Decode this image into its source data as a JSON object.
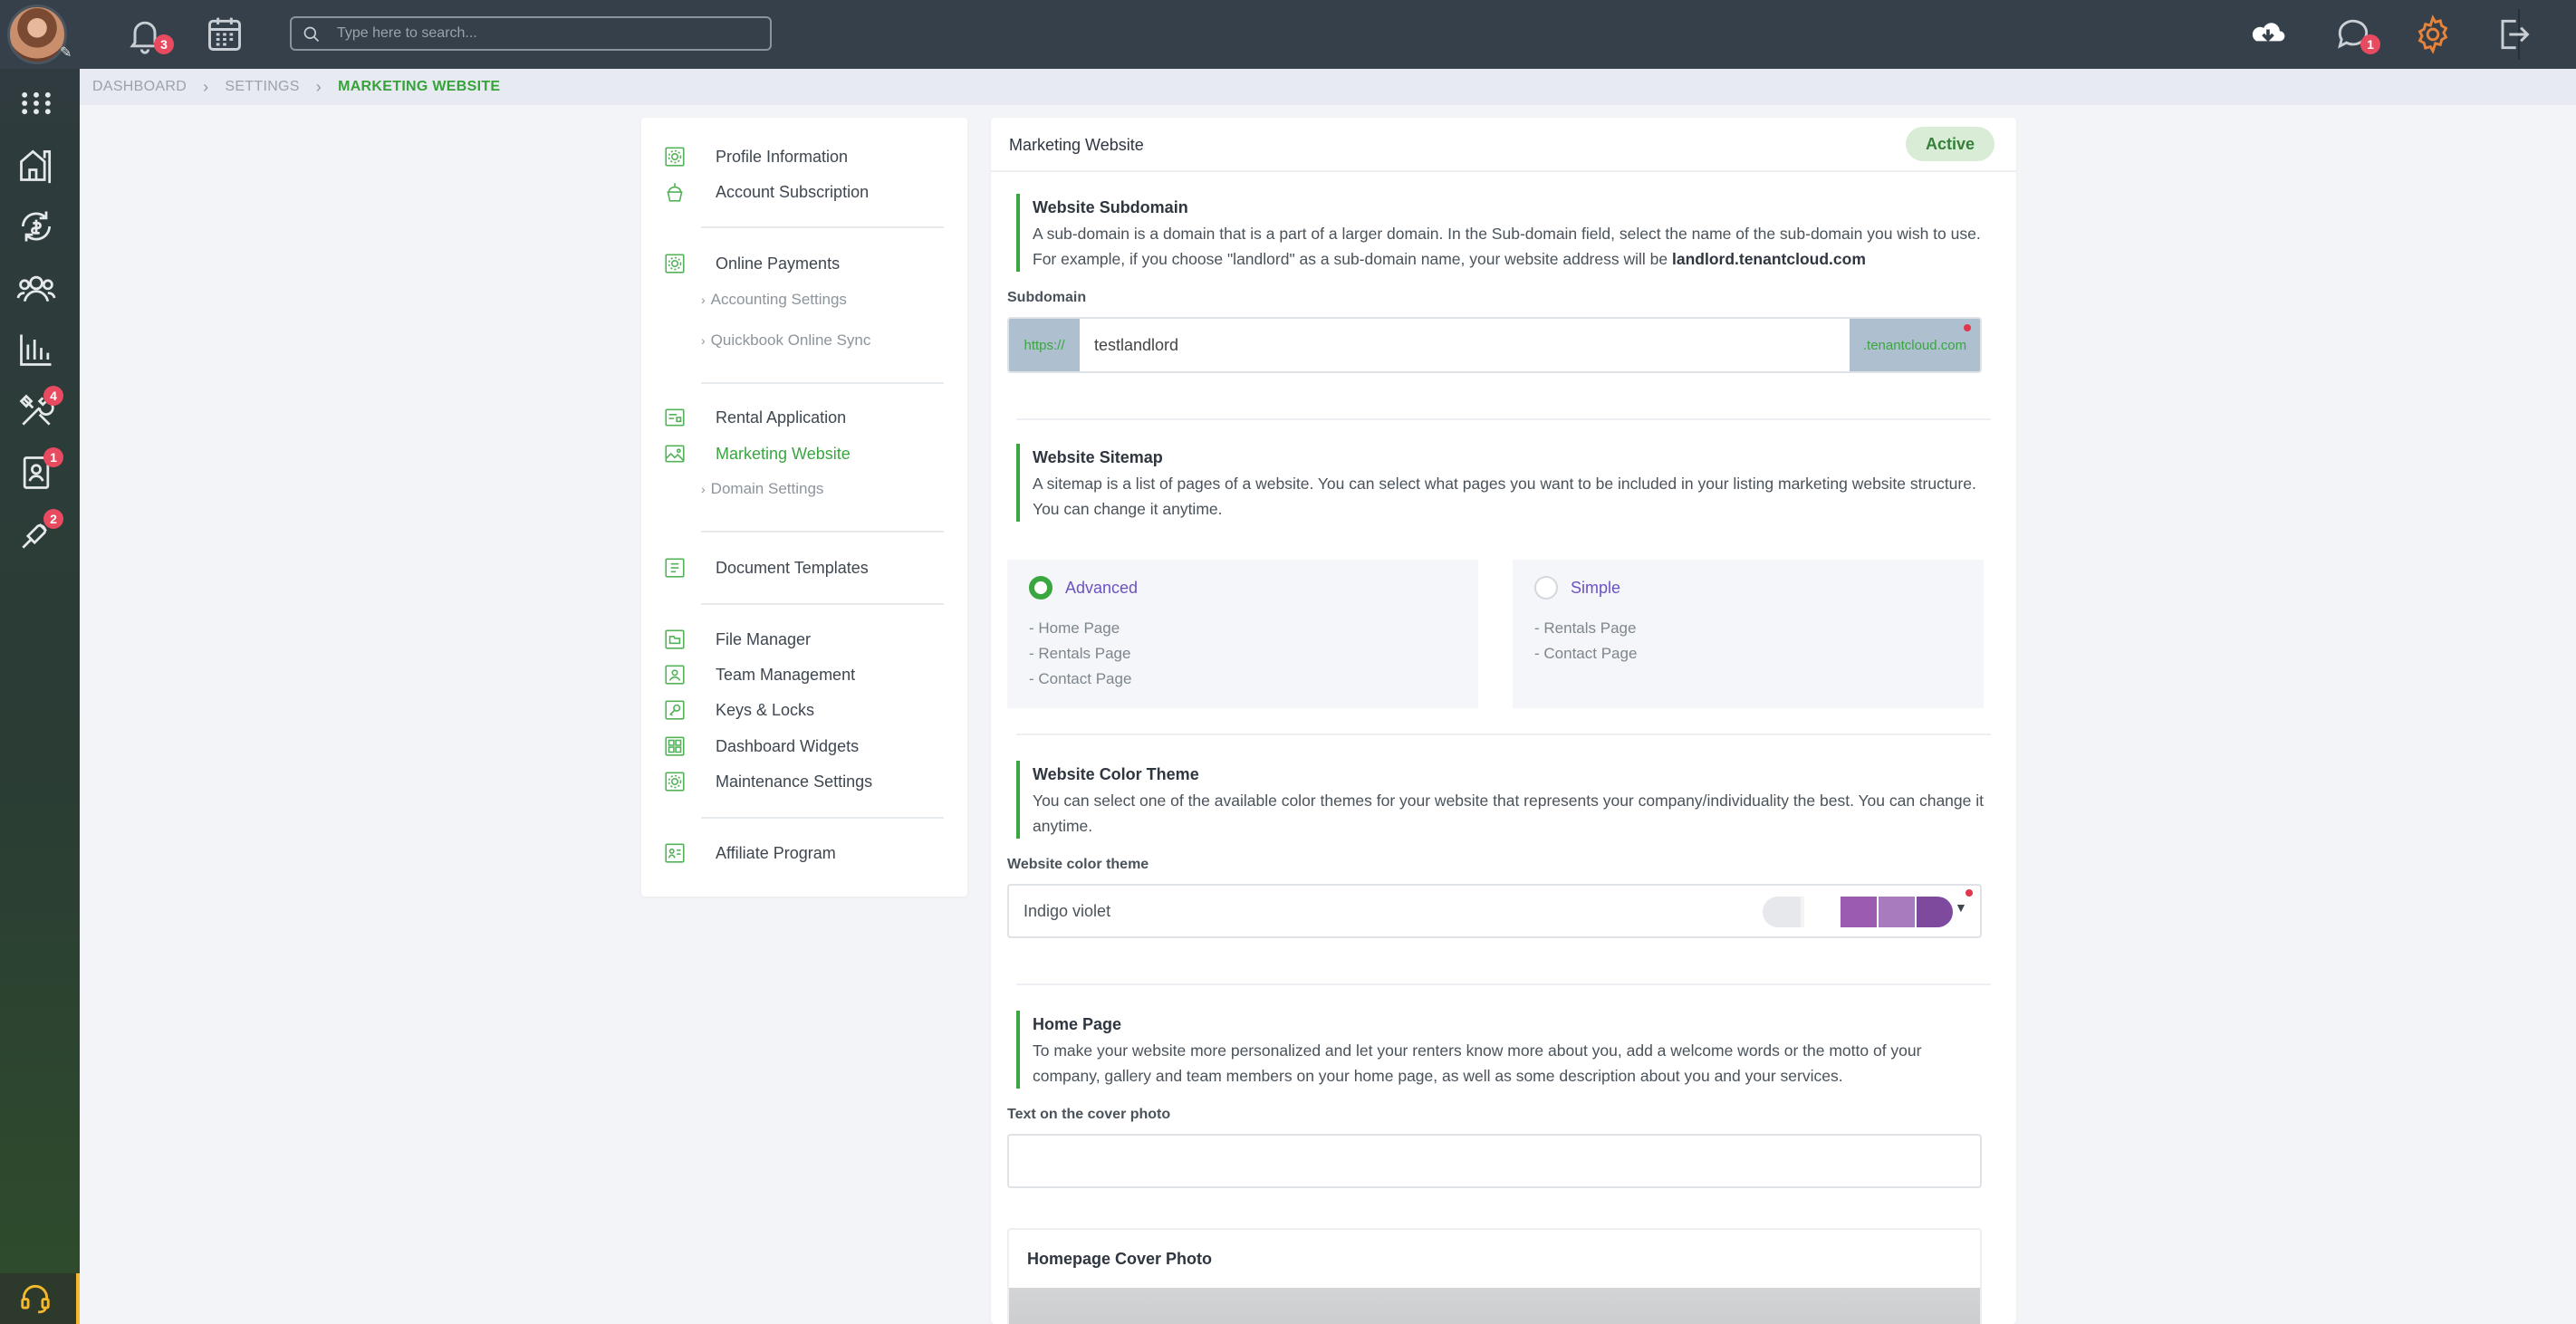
{
  "topbar": {
    "notifications_count": "3",
    "messages_count": "1",
    "search_placeholder": "Type here to search..."
  },
  "sidebar": {
    "badges": {
      "maintenance": "4",
      "applications": "1",
      "integrations": "2"
    }
  },
  "breadcrumb": {
    "items": [
      "DASHBOARD",
      "SETTINGS",
      "MARKETING WEBSITE"
    ]
  },
  "menu": {
    "items": [
      {
        "label": "Profile Information",
        "icon": "profile-settings-icon"
      },
      {
        "label": "Account Subscription",
        "icon": "cupcake-icon"
      },
      {
        "label": "Online Payments",
        "icon": "payments-settings-icon"
      },
      {
        "label": "Accounting Settings",
        "icon": "chevron-right-icon"
      },
      {
        "label": "Quickbook Online Sync",
        "icon": "chevron-right-icon"
      },
      {
        "label": "Rental Application",
        "icon": "application-icon"
      },
      {
        "label": "Marketing Website",
        "icon": "image-icon"
      },
      {
        "label": "Domain Settings",
        "icon": "chevron-right-icon"
      },
      {
        "label": "Document Templates",
        "icon": "document-icon"
      },
      {
        "label": "File Manager",
        "icon": "file-manager-icon"
      },
      {
        "label": "Team Management",
        "icon": "team-icon"
      },
      {
        "label": "Keys & Locks",
        "icon": "key-icon"
      },
      {
        "label": "Dashboard Widgets",
        "icon": "widgets-icon"
      },
      {
        "label": "Maintenance Settings",
        "icon": "maintenance-settings-icon"
      },
      {
        "label": "Affiliate Program",
        "icon": "affiliate-icon"
      }
    ],
    "active": "Marketing Website"
  },
  "main": {
    "title": "Marketing Website",
    "status": "Active",
    "subdomain_section": {
      "title": "Website Subdomain",
      "desc": "A sub-domain is a domain that is a part of a larger domain. In the Sub-domain field, select the name of the sub-domain you wish to use. For example, if you choose \"landlord\" as a sub-domain name, your website address will be ",
      "desc_bold": "landlord.tenantcloud.com",
      "label": "Subdomain",
      "prefix": "https://",
      "value": "testlandlord",
      "suffix": ".tenantcloud.com"
    },
    "sitemap_section": {
      "title": "Website Sitemap",
      "desc": "A sitemap is a list of pages of a website. You can select what pages you want to be included in your listing marketing website structure. You can change it anytime.",
      "options": [
        {
          "label": "Advanced",
          "selected": true,
          "pages": [
            "- Home Page",
            "- Rentals Page",
            "- Contact Page"
          ]
        },
        {
          "label": "Simple",
          "selected": false,
          "pages": [
            "- Rentals Page",
            "- Contact Page"
          ]
        }
      ]
    },
    "color_section": {
      "title": "Website Color Theme",
      "desc": "You can select one of the available color themes for your website that represents your company/individuality the best. You can change it anytime.",
      "label": "Website color theme",
      "value": "Indigo violet",
      "swatches": [
        "#9b5cb0",
        "#a77bbd",
        "#7d4a9e"
      ]
    },
    "home_section": {
      "title": "Home Page",
      "desc": "To make your website more personalized and let your renters know more about you, add a welcome words or the motto of your company, gallery and team members on your home page, as well as some description about you and your services.",
      "label": "Text on the cover photo",
      "value": ""
    },
    "cover_card": {
      "title": "Homepage Cover Photo"
    }
  },
  "colors": {
    "accent_green": "#3aa640",
    "topbar": "#36404a",
    "badge_red": "#e84a5f",
    "option_purple": "#6b52c4"
  }
}
